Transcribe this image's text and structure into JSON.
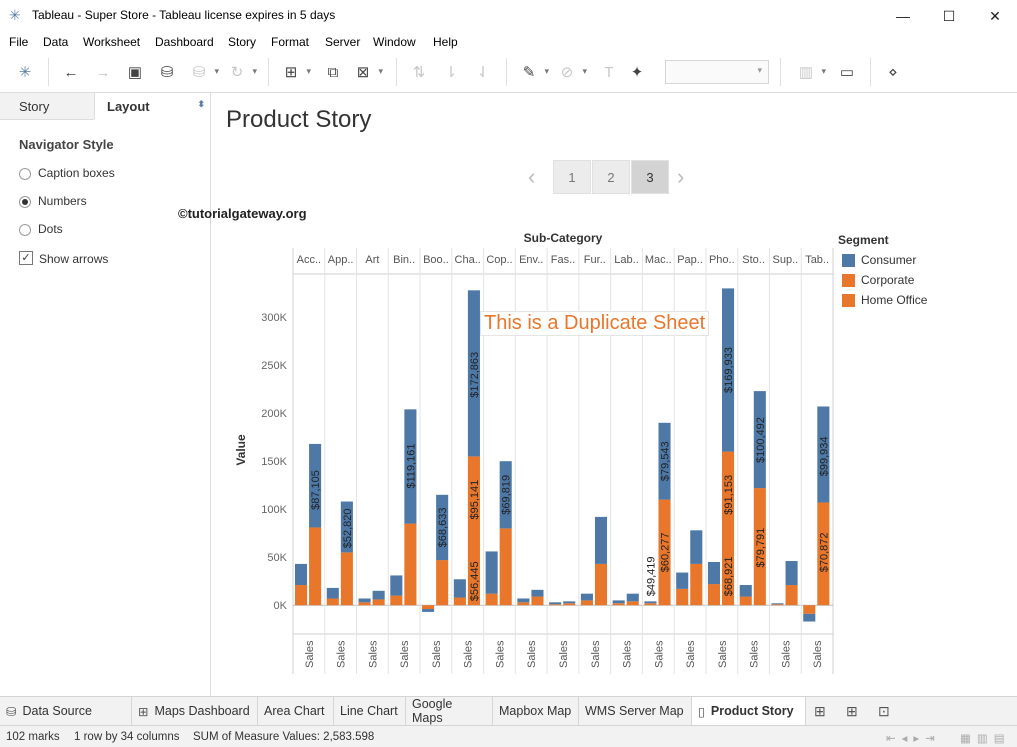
{
  "window": {
    "title": "Tableau - Super Store - Tableau license expires in 5 days"
  },
  "menu": [
    "File",
    "Data",
    "Worksheet",
    "Dashboard",
    "Story",
    "Format",
    "Server",
    "Window",
    "Help"
  ],
  "left_pane": {
    "tabs": [
      "Story",
      "Layout"
    ],
    "section_title": "Navigator Style",
    "options": [
      "Caption boxes",
      "Numbers",
      "Dots"
    ],
    "selected_option": "Numbers",
    "show_arrows_label": "Show arrows"
  },
  "story": {
    "title": "Product Story",
    "nav_prev": "‹",
    "nav_next": "›",
    "points": [
      "1",
      "2",
      "3"
    ],
    "active_point": "3"
  },
  "watermark": "©tutorialgateway.org",
  "annotation": "This is a Duplicate Sheet",
  "colors": {
    "Consumer": "#4e79a7",
    "Corporate": "#e8762b",
    "Home Office": "#e8762b"
  },
  "chart_data": {
    "type": "bar",
    "stacked": true,
    "title": "Sub-Category",
    "ylabel": "Value",
    "ylim": [
      -30000,
      345000
    ],
    "yticks": [
      "0K",
      "50K",
      "100K",
      "150K",
      "200K",
      "250K",
      "300K"
    ],
    "column_label": "Sales",
    "legend_title": "Segment",
    "legend": [
      "Consumer",
      "Corporate",
      "Home Office"
    ],
    "categories": [
      "Acc..",
      "App..",
      "Art",
      "Bin..",
      "Boo..",
      "Cha..",
      "Cop..",
      "Env..",
      "Fas..",
      "Fur..",
      "Lab..",
      "Mac..",
      "Pap..",
      "Pho..",
      "Sto..",
      "Sup..",
      "Tab.."
    ],
    "series": [
      {
        "name": "Consumer",
        "values": [
          [
            21000,
            43000
          ],
          [
            7000,
            18000
          ],
          [
            3000,
            7000
          ],
          [
            10000,
            31000
          ],
          [
            -4000,
            -7000
          ],
          [
            8000,
            27000
          ],
          [
            12000,
            56000
          ],
          [
            3000,
            7000
          ],
          [
            1000,
            3000
          ],
          [
            5000,
            12000
          ],
          [
            2000,
            5000
          ],
          [
            2000,
            4000
          ],
          [
            17000,
            34000
          ],
          [
            22000,
            45000
          ],
          [
            9000,
            21000
          ],
          [
            1000,
            2000
          ],
          [
            -9000,
            -17000
          ]
        ],
        "second_values": [
          [
            81000,
            168000
          ],
          [
            55000,
            108000
          ],
          [
            6000,
            15000
          ],
          [
            85000,
            204000
          ],
          [
            47000,
            115000
          ],
          [
            155000,
            328000
          ],
          [
            80000,
            150000
          ],
          [
            9000,
            16000
          ],
          [
            2000,
            4000
          ],
          [
            43000,
            92000
          ],
          [
            4000,
            12000
          ],
          [
            110000,
            190000
          ],
          [
            43000,
            78000
          ],
          [
            160000,
            330000
          ],
          [
            122000,
            223000
          ],
          [
            21000,
            46000
          ],
          [
            107000,
            207000
          ]
        ]
      },
      {
        "name": "Corporate",
        "values": []
      },
      {
        "name": "Home Office",
        "values": []
      }
    ],
    "bar_labels": [
      {
        "cat": "Acc..",
        "bar": 2,
        "text": "$87,105",
        "at": 120000
      },
      {
        "cat": "App..",
        "bar": 2,
        "text": "$52,820",
        "at": 80000
      },
      {
        "cat": "Bin..",
        "bar": 2,
        "text": "$119,161",
        "at": 145000
      },
      {
        "cat": "Boo..",
        "bar": 2,
        "text": "$68,633",
        "at": 81000
      },
      {
        "cat": "Cha..",
        "bar": 2,
        "text": "$172,863",
        "at": 240000
      },
      {
        "cat": "Cha..",
        "bar": 2,
        "text": "$95,141",
        "at": 110000
      },
      {
        "cat": "Cha..",
        "bar": 2,
        "text": "$56,445",
        "at": 25000
      },
      {
        "cat": "Cop..",
        "bar": 2,
        "text": "$69,819",
        "at": 115000
      },
      {
        "cat": "Mac..",
        "bar": 2,
        "text": "$79,543",
        "at": 150000
      },
      {
        "cat": "Mac..",
        "bar": 2,
        "text": "$60,277",
        "at": 55000
      },
      {
        "cat": "Mac..",
        "bar": 1,
        "text": "$49,419",
        "at": 30000
      },
      {
        "cat": "Pho..",
        "bar": 2,
        "text": "$169,933",
        "at": 245000
      },
      {
        "cat": "Pho..",
        "bar": 2,
        "text": "$91,153",
        "at": 115000
      },
      {
        "cat": "Pho..",
        "bar": 2,
        "text": "$68,921",
        "at": 30000
      },
      {
        "cat": "Sto..",
        "bar": 2,
        "text": "$100,492",
        "at": 172000
      },
      {
        "cat": "Sto..",
        "bar": 2,
        "text": "$79,791",
        "at": 60000
      },
      {
        "cat": "Tab..",
        "bar": 2,
        "text": "$99,934",
        "at": 155000
      },
      {
        "cat": "Tab..",
        "bar": 2,
        "text": "$70,872",
        "at": 55000
      }
    ]
  },
  "sheet_tabs": [
    "Data Source",
    "Maps Dashboard",
    "Area Chart",
    "Line Chart",
    "Google Maps",
    "Mapbox Map",
    "WMS Server Map",
    "Product Story"
  ],
  "active_sheet": "Product Story",
  "status": {
    "marks": "102 marks",
    "layout": "1 row by 34 columns",
    "sum": "SUM of Measure Values: 2,583.598"
  }
}
